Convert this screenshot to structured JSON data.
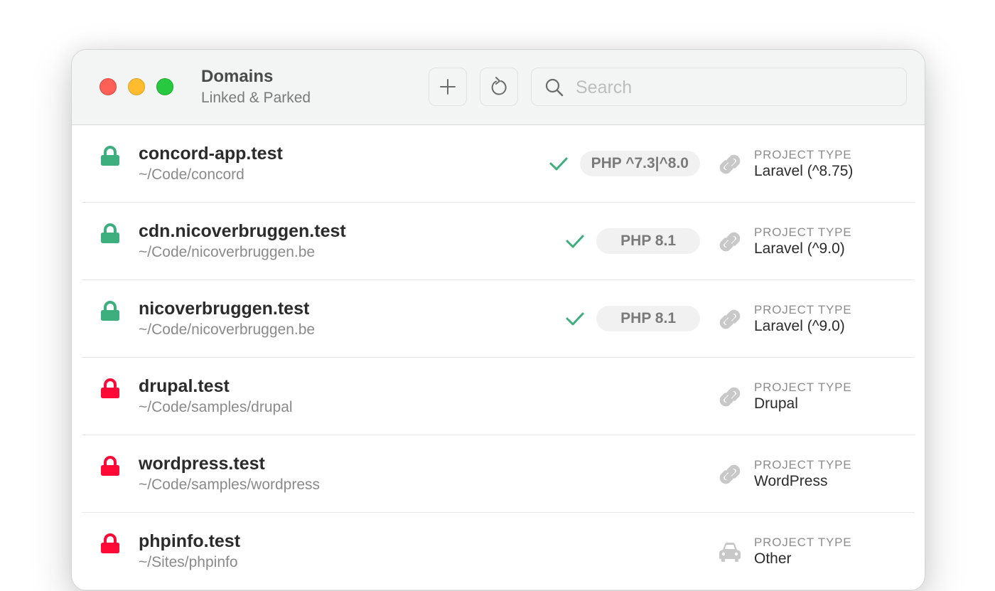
{
  "window": {
    "title": "Domains",
    "subtitle": "Linked & Parked",
    "traffic_lights": {
      "close": "#fe5f57",
      "minimize": "#febc2e",
      "maximize": "#28c840"
    }
  },
  "toolbar": {
    "add_icon": "plus-icon",
    "refresh_icon": "refresh-icon",
    "search_icon": "search-icon",
    "search_placeholder": "Search",
    "search_value": ""
  },
  "colors": {
    "secure": "#3daf7e",
    "insecure": "#ff0a36",
    "check": "#3daf7e"
  },
  "project_type_label": "PROJECT TYPE",
  "domains": [
    {
      "name": "concord-app.test",
      "path": "~/Code/concord",
      "secure": true,
      "php_ok": true,
      "php": "PHP ^7.3|^8.0",
      "type_icon": "link-icon",
      "project_type": "Laravel (^8.75)"
    },
    {
      "name": "cdn.nicoverbruggen.test",
      "path": "~/Code/nicoverbruggen.be",
      "secure": true,
      "php_ok": true,
      "php": "PHP 8.1",
      "type_icon": "link-icon",
      "project_type": "Laravel (^9.0)"
    },
    {
      "name": "nicoverbruggen.test",
      "path": "~/Code/nicoverbruggen.be",
      "secure": true,
      "php_ok": true,
      "php": "PHP 8.1",
      "type_icon": "link-icon",
      "project_type": "Laravel (^9.0)"
    },
    {
      "name": "drupal.test",
      "path": "~/Code/samples/drupal",
      "secure": false,
      "php_ok": false,
      "php": null,
      "type_icon": "link-icon",
      "project_type": "Drupal"
    },
    {
      "name": "wordpress.test",
      "path": "~/Code/samples/wordpress",
      "secure": false,
      "php_ok": false,
      "php": null,
      "type_icon": "link-icon",
      "project_type": "WordPress"
    },
    {
      "name": "phpinfo.test",
      "path": "~/Sites/phpinfo",
      "secure": false,
      "php_ok": false,
      "php": null,
      "type_icon": "car-icon",
      "project_type": "Other"
    }
  ]
}
